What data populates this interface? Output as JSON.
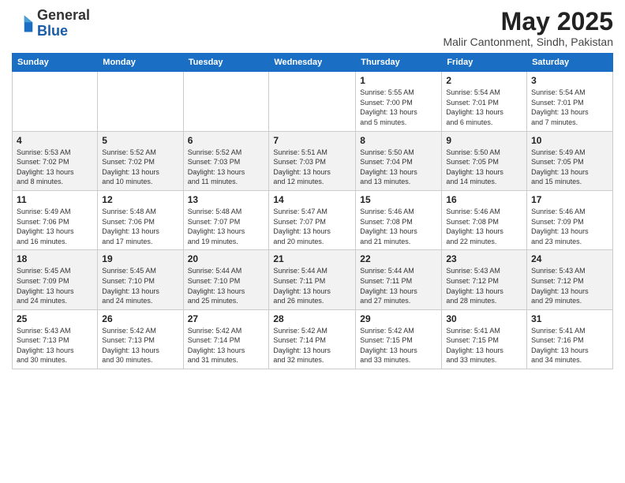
{
  "header": {
    "logo_general": "General",
    "logo_blue": "Blue",
    "month": "May 2025",
    "location": "Malir Cantonment, Sindh, Pakistan"
  },
  "days_of_week": [
    "Sunday",
    "Monday",
    "Tuesday",
    "Wednesday",
    "Thursday",
    "Friday",
    "Saturday"
  ],
  "weeks": [
    [
      {
        "day": "",
        "info": ""
      },
      {
        "day": "",
        "info": ""
      },
      {
        "day": "",
        "info": ""
      },
      {
        "day": "",
        "info": ""
      },
      {
        "day": "1",
        "info": "Sunrise: 5:55 AM\nSunset: 7:00 PM\nDaylight: 13 hours\nand 5 minutes."
      },
      {
        "day": "2",
        "info": "Sunrise: 5:54 AM\nSunset: 7:01 PM\nDaylight: 13 hours\nand 6 minutes."
      },
      {
        "day": "3",
        "info": "Sunrise: 5:54 AM\nSunset: 7:01 PM\nDaylight: 13 hours\nand 7 minutes."
      }
    ],
    [
      {
        "day": "4",
        "info": "Sunrise: 5:53 AM\nSunset: 7:02 PM\nDaylight: 13 hours\nand 8 minutes."
      },
      {
        "day": "5",
        "info": "Sunrise: 5:52 AM\nSunset: 7:02 PM\nDaylight: 13 hours\nand 10 minutes."
      },
      {
        "day": "6",
        "info": "Sunrise: 5:52 AM\nSunset: 7:03 PM\nDaylight: 13 hours\nand 11 minutes."
      },
      {
        "day": "7",
        "info": "Sunrise: 5:51 AM\nSunset: 7:03 PM\nDaylight: 13 hours\nand 12 minutes."
      },
      {
        "day": "8",
        "info": "Sunrise: 5:50 AM\nSunset: 7:04 PM\nDaylight: 13 hours\nand 13 minutes."
      },
      {
        "day": "9",
        "info": "Sunrise: 5:50 AM\nSunset: 7:05 PM\nDaylight: 13 hours\nand 14 minutes."
      },
      {
        "day": "10",
        "info": "Sunrise: 5:49 AM\nSunset: 7:05 PM\nDaylight: 13 hours\nand 15 minutes."
      }
    ],
    [
      {
        "day": "11",
        "info": "Sunrise: 5:49 AM\nSunset: 7:06 PM\nDaylight: 13 hours\nand 16 minutes."
      },
      {
        "day": "12",
        "info": "Sunrise: 5:48 AM\nSunset: 7:06 PM\nDaylight: 13 hours\nand 17 minutes."
      },
      {
        "day": "13",
        "info": "Sunrise: 5:48 AM\nSunset: 7:07 PM\nDaylight: 13 hours\nand 19 minutes."
      },
      {
        "day": "14",
        "info": "Sunrise: 5:47 AM\nSunset: 7:07 PM\nDaylight: 13 hours\nand 20 minutes."
      },
      {
        "day": "15",
        "info": "Sunrise: 5:46 AM\nSunset: 7:08 PM\nDaylight: 13 hours\nand 21 minutes."
      },
      {
        "day": "16",
        "info": "Sunrise: 5:46 AM\nSunset: 7:08 PM\nDaylight: 13 hours\nand 22 minutes."
      },
      {
        "day": "17",
        "info": "Sunrise: 5:46 AM\nSunset: 7:09 PM\nDaylight: 13 hours\nand 23 minutes."
      }
    ],
    [
      {
        "day": "18",
        "info": "Sunrise: 5:45 AM\nSunset: 7:09 PM\nDaylight: 13 hours\nand 24 minutes."
      },
      {
        "day": "19",
        "info": "Sunrise: 5:45 AM\nSunset: 7:10 PM\nDaylight: 13 hours\nand 24 minutes."
      },
      {
        "day": "20",
        "info": "Sunrise: 5:44 AM\nSunset: 7:10 PM\nDaylight: 13 hours\nand 25 minutes."
      },
      {
        "day": "21",
        "info": "Sunrise: 5:44 AM\nSunset: 7:11 PM\nDaylight: 13 hours\nand 26 minutes."
      },
      {
        "day": "22",
        "info": "Sunrise: 5:44 AM\nSunset: 7:11 PM\nDaylight: 13 hours\nand 27 minutes."
      },
      {
        "day": "23",
        "info": "Sunrise: 5:43 AM\nSunset: 7:12 PM\nDaylight: 13 hours\nand 28 minutes."
      },
      {
        "day": "24",
        "info": "Sunrise: 5:43 AM\nSunset: 7:12 PM\nDaylight: 13 hours\nand 29 minutes."
      }
    ],
    [
      {
        "day": "25",
        "info": "Sunrise: 5:43 AM\nSunset: 7:13 PM\nDaylight: 13 hours\nand 30 minutes."
      },
      {
        "day": "26",
        "info": "Sunrise: 5:42 AM\nSunset: 7:13 PM\nDaylight: 13 hours\nand 30 minutes."
      },
      {
        "day": "27",
        "info": "Sunrise: 5:42 AM\nSunset: 7:14 PM\nDaylight: 13 hours\nand 31 minutes."
      },
      {
        "day": "28",
        "info": "Sunrise: 5:42 AM\nSunset: 7:14 PM\nDaylight: 13 hours\nand 32 minutes."
      },
      {
        "day": "29",
        "info": "Sunrise: 5:42 AM\nSunset: 7:15 PM\nDaylight: 13 hours\nand 33 minutes."
      },
      {
        "day": "30",
        "info": "Sunrise: 5:41 AM\nSunset: 7:15 PM\nDaylight: 13 hours\nand 33 minutes."
      },
      {
        "day": "31",
        "info": "Sunrise: 5:41 AM\nSunset: 7:16 PM\nDaylight: 13 hours\nand 34 minutes."
      }
    ]
  ]
}
